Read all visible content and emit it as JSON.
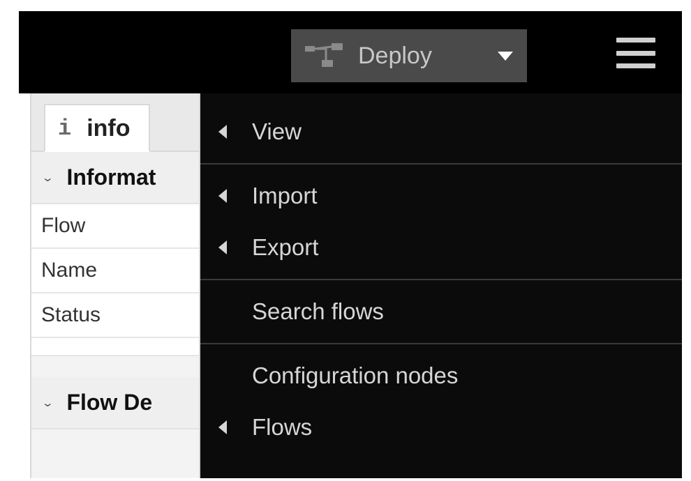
{
  "header": {
    "deploy_label": "Deploy"
  },
  "sidebar": {
    "tab": {
      "icon_letter": "i",
      "label": "info"
    },
    "sections": {
      "information": {
        "title": "Informat"
      },
      "flow_description": {
        "title": "Flow De"
      }
    },
    "rows": {
      "flow": "Flow",
      "name": "Name",
      "status": "Status"
    }
  },
  "menu": {
    "items": {
      "view": "View",
      "import": "Import",
      "export": "Export",
      "search_flows": "Search flows",
      "config_nodes": "Configuration nodes",
      "flows": "Flows"
    }
  }
}
